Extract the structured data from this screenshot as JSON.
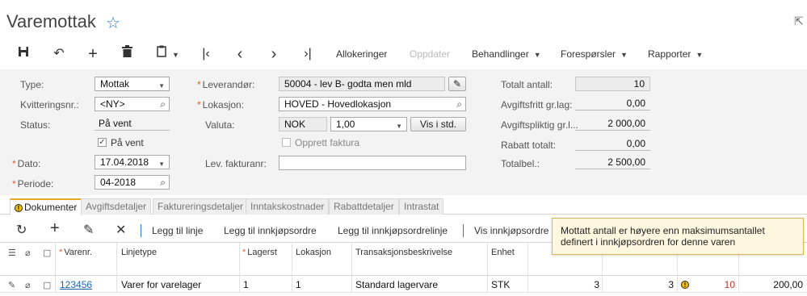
{
  "page": {
    "title": "Varemottak"
  },
  "toolbar": {
    "allokeringer": "Allokeringer",
    "oppdater": "Oppdater",
    "behandlinger": "Behandlinger",
    "foresporsler": "Forespørsler",
    "rapporter": "Rapporter"
  },
  "form": {
    "type_label": "Type:",
    "type_value": "Mottak",
    "kvittering_label": "Kvitteringsnr.:",
    "kvittering_value": "<NY>",
    "status_label": "Status:",
    "status_value": "På vent",
    "pavent_checkbox_label": "På vent",
    "dato_label": "Dato:",
    "dato_value": "17.04.2018",
    "periode_label": "Periode:",
    "periode_value": "04-2018",
    "leverandor_label": "Leverandør:",
    "leverandor_value": "50004 - lev B- godta men mld",
    "lokasjon_label": "Lokasjon:",
    "lokasjon_value": "HOVED - Hovedlokasjon",
    "valuta_label": "Valuta:",
    "valuta_value": "NOK",
    "kurs_value": "1,00",
    "vis_std_label": "Vis i std.",
    "opprett_faktura_label": "Opprett faktura",
    "lev_fakturanr_label": "Lev. fakturanr:",
    "lev_fakturanr_value": "",
    "totalt_antall_label": "Totalt antall:",
    "totalt_antall_value": "10",
    "avgiftsfritt_label": "Avgiftsfritt gr.lag:",
    "avgiftsfritt_value": "0,00",
    "avgiftspliktig_label": "Avgiftspliktig gr.l...",
    "avgiftspliktig_value": "2 000,00",
    "rabatt_label": "Rabatt totalt:",
    "rabatt_value": "0,00",
    "totalbel_label": "Totalbel.:",
    "totalbel_value": "2 500,00"
  },
  "tabs": [
    {
      "label": "Dokumenter"
    },
    {
      "label": "Avgiftsdetaljer"
    },
    {
      "label": "Faktureringsdetaljer"
    },
    {
      "label": "Inntakskostnader"
    },
    {
      "label": "Rabattdetaljer"
    },
    {
      "label": "Intrastat"
    }
  ],
  "grid_toolbar": {
    "legg_til_linje": "Legg til linje",
    "legg_til_innkjopsordre": "Legg til innkjøpsordre",
    "legg_til_innkjopsordrelinje": "Legg til innkjøpsordrelinje",
    "vis_innkjopsordre": "Vis innkjøpsordre"
  },
  "tooltip": {
    "text": "Mottatt antall er høyere enn maksimumsantallet definert i innkjøpsordren for denne varen"
  },
  "table": {
    "headers": {
      "varenr": "Varenr.",
      "linjetype": "Linjetype",
      "lagerst": "Lagerst",
      "lokasjon": "Lokasjon",
      "transaksjon": "Transaksjonsbeskrivelse",
      "enhet": "Enhet"
    },
    "row": {
      "varenr": "123456",
      "linjetype": "Varer for varelager",
      "lagerst": "1",
      "lokasjon": "1",
      "transaksjon": "Standard lagervare",
      "enhet": "STK",
      "c1": "3",
      "c2": "3",
      "warn_qty": "10",
      "amount": "200,00"
    }
  },
  "colors": {
    "accent": "#2b7bd6",
    "warning": "#f2c200",
    "link": "#1f64b4"
  }
}
